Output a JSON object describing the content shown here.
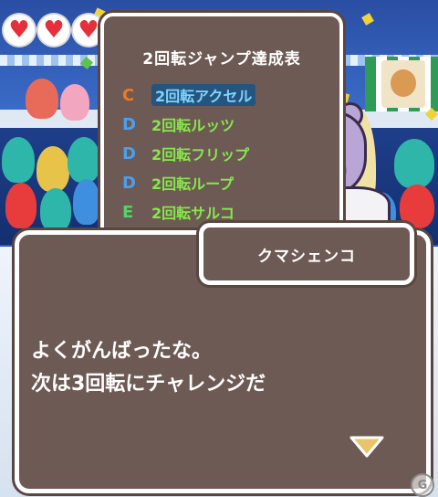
{
  "hud": {
    "hearts": [
      "heart-icon",
      "heart-icon",
      "heart-icon"
    ]
  },
  "achievement_table": {
    "title": "2回転ジャンプ達成表",
    "rows": [
      {
        "grade": "C",
        "jump": "2回転アクセル",
        "grade_color": "#f07a1e",
        "selected": true
      },
      {
        "grade": "D",
        "jump": "2回転ルッツ",
        "grade_color": "#4aa0f0",
        "selected": false
      },
      {
        "grade": "D",
        "jump": "2回転フリップ",
        "grade_color": "#4aa0f0",
        "selected": false
      },
      {
        "grade": "D",
        "jump": "2回転ループ",
        "grade_color": "#4aa0f0",
        "selected": false
      },
      {
        "grade": "E",
        "jump": "2回転サルコ",
        "grade_color": "#56d26a",
        "selected": false
      }
    ]
  },
  "dialogue": {
    "speaker": "クマシェンコ",
    "lines": [
      "よくがんばったな。",
      "次は3回転にチャレンジだ"
    ],
    "advance_icon": "down-triangle-icon"
  },
  "colors": {
    "panel_bg": "#6e5a54",
    "panel_border": "#ffffff",
    "jump_text": "#86e84a",
    "selected_text": "#7fd3ff"
  },
  "watermark": {
    "text": "G"
  }
}
